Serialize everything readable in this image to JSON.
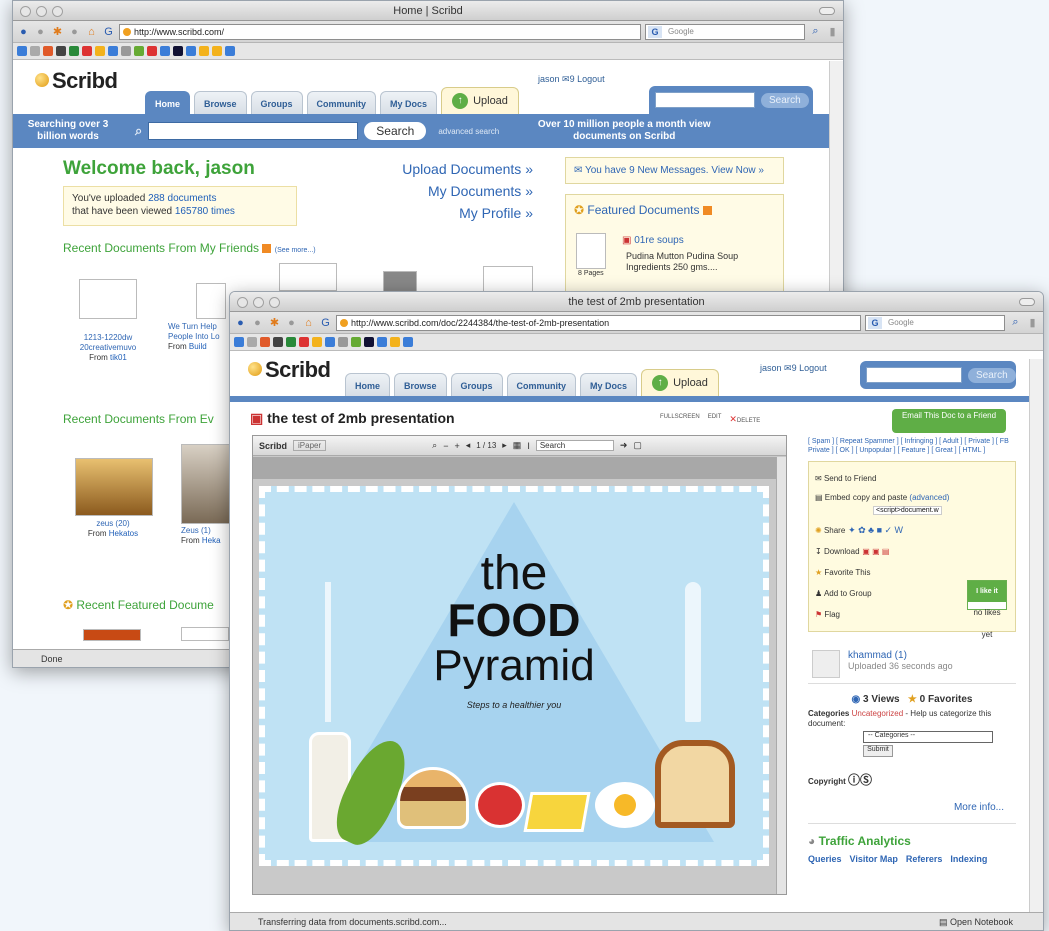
{
  "back": {
    "window_title": "Home | Scribd",
    "url": "http://www.scribd.com/",
    "search_engine": "Google",
    "logo": "Scribd",
    "tabs": [
      "Home",
      "Browse",
      "Groups",
      "Community",
      "My Docs"
    ],
    "upload_label": "Upload",
    "user": "jason",
    "messages": "9",
    "logout": "Logout",
    "top_search_btn": "Search",
    "bar_left": "Searching over 3 billion words",
    "search_btn": "Search",
    "advanced": "advanced search",
    "bar_right": "Over 10 million people a month view documents on Scribd",
    "welcome": "Welcome back, jason",
    "uploaded_line1_pre": "You've uploaded ",
    "uploaded_docs": "288 documents",
    "uploaded_line2_pre": "that have been viewed ",
    "viewed_times": "165780 times",
    "links": [
      "Upload Documents »",
      "My Documents »",
      "My Profile »"
    ],
    "new_messages": "You have 9 New Messages. View Now »",
    "featured_title": "Featured Documents",
    "featured_doc": "01re soups",
    "featured_desc": "Pudina Mutton Pudina Soup Ingredients 250 gms....",
    "featured_pages": "8 Pages",
    "friends_title": "Recent Documents From My Friends",
    "see_more": "(See more...)",
    "doc1_title": "1213-1220dw 20creativemuvo",
    "doc1_from": "From ",
    "doc1_user": "tik01",
    "doc2_title": "We Turn Help People Into Lo",
    "doc2_from": "From ",
    "doc2_user": "Build",
    "everyone_title": "Recent Documents From Ev",
    "zeus1": "zeus (20)",
    "zeus1_from": "From ",
    "zeus1_user": "Hekatos",
    "zeus2": "Zeus (1)",
    "zeus2_from": "From ",
    "zeus2_user": "Heka",
    "featured_section": "Recent Featured Docume",
    "status": "Done"
  },
  "front": {
    "window_title": "the test of 2mb presentation",
    "url": "http://www.scribd.com/doc/2244384/the-test-of-2mb-presentation",
    "search_engine": "Google",
    "logo": "Scribd",
    "tabs": [
      "Home",
      "Browse",
      "Groups",
      "Community",
      "My Docs"
    ],
    "upload_label": "Upload",
    "user": "jason",
    "messages": "9",
    "logout": "Logout",
    "top_search_btn": "Search",
    "doc_title": "the test of 2mb presentation",
    "tools": [
      "FULLSCREEN",
      "EDIT",
      "DELETE"
    ],
    "viewer_logo": "Scribd",
    "viewer_mode": "iPaper",
    "page_indicator": "1 / 13",
    "viewer_search": "Search",
    "slide": {
      "line1": "the",
      "line2": "FOOD",
      "line3": "Pyramid",
      "subtitle": "Steps to a healthier you"
    },
    "email_btn": "Email This Doc to a Friend",
    "flag_links": "[ Spam ] [ Repeat Spammer ] [ Infringing ] [ Adult ] [ Private ] [ FB Private ] [ OK ] [ Unpopular ] [ Feature ] [ Great ] [ HTML ]",
    "actions": {
      "send": "Send to Friend",
      "embed": "Embed",
      "embed_hint": "copy and paste ",
      "embed_adv": "(advanced)",
      "embed_code": "<script>document.w",
      "share": "Share",
      "download": "Download",
      "favorite": "Favorite This",
      "add_group": "Add to Group",
      "flag": "Flag"
    },
    "like": {
      "label": "I like it",
      "sub": "no likes yet"
    },
    "uploader": "khammad (1)",
    "uploaded_ago": "Uploaded 36 seconds ago",
    "views": "3 Views",
    "favorites": "0 Favorites",
    "categories_label": "Categories",
    "uncategorized": "Uncategorized",
    "cat_help": " - Help us categorize this document:",
    "cat_select": "-- Categories --",
    "submit": "Submit",
    "copyright_label": "Copyright",
    "more_info": "More info...",
    "traffic_title": "Traffic Analytics",
    "traffic_links": [
      "Queries",
      "Visitor Map",
      "Referers",
      "Indexing"
    ],
    "status": "Transferring data from documents.scribd.com...",
    "open_notebook": "Open Notebook"
  }
}
